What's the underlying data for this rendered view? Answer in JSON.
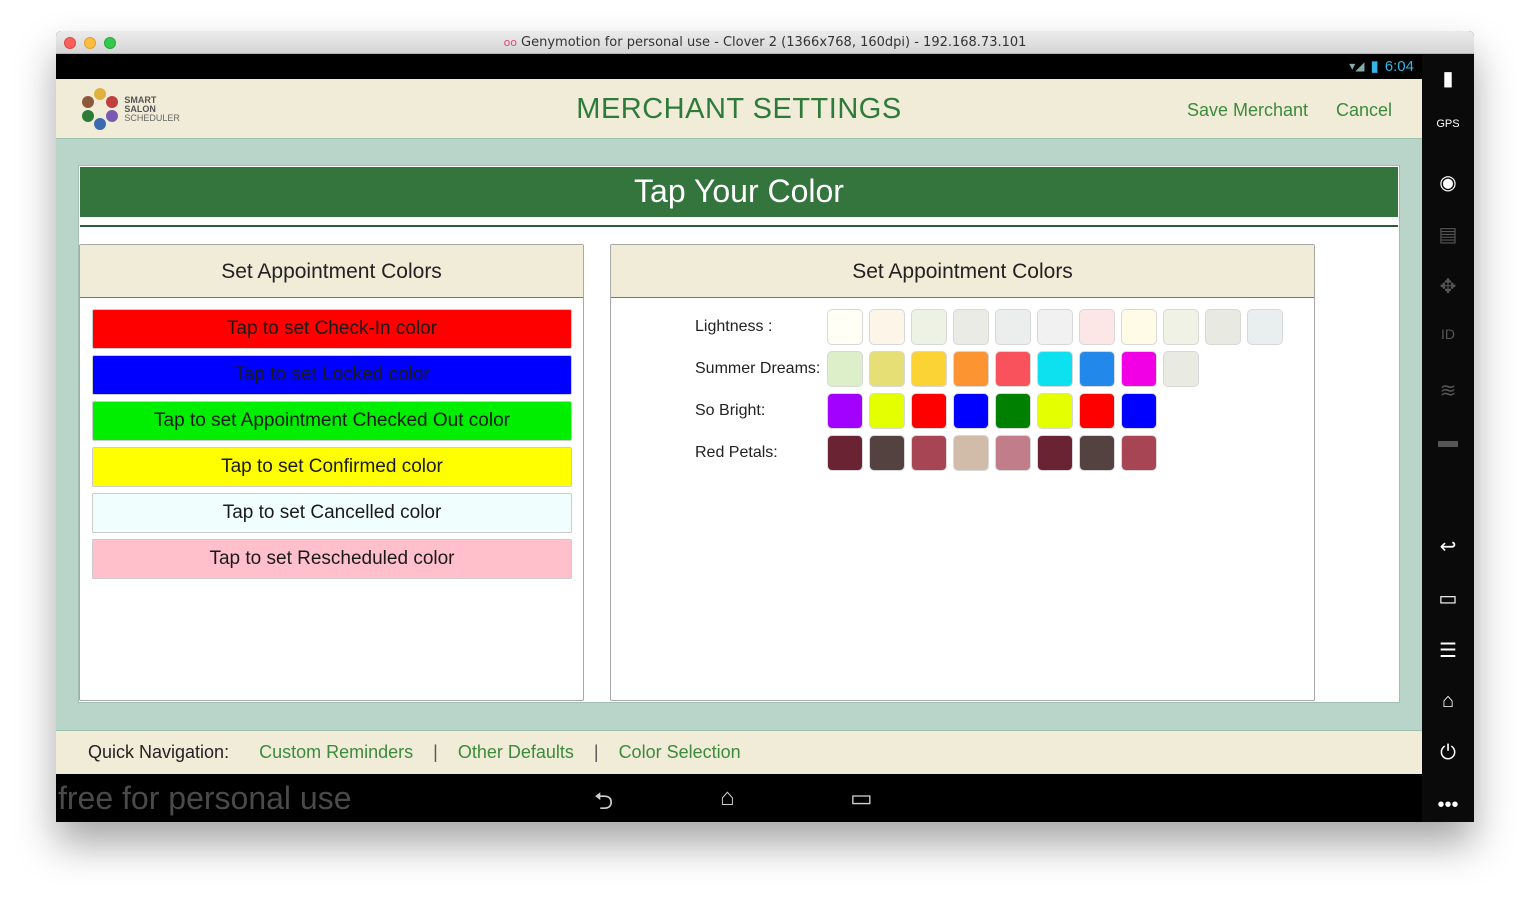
{
  "window": {
    "title": "Genymotion for personal use - Clover 2 (1366x768, 160dpi) - 192.168.73.101"
  },
  "statusbar": {
    "time": "6:04"
  },
  "header": {
    "logo_line1": "SMART SALON",
    "logo_line2": "SCHEDULER",
    "title": "MERCHANT SETTINGS",
    "save_label": "Save Merchant",
    "cancel_label": "Cancel"
  },
  "banner": {
    "title": "Tap Your Color"
  },
  "left_panel": {
    "heading": "Set Appointment Colors",
    "buttons": [
      {
        "label": "Tap to set Check-In color",
        "bg": "#ff0000",
        "fg": "#1a1a1a"
      },
      {
        "label": "Tap to set Locked color",
        "bg": "#0000ff",
        "fg": "#1a1a1a"
      },
      {
        "label": "Tap to set Appointment Checked Out color",
        "bg": "#00ee00",
        "fg": "#1a1a1a"
      },
      {
        "label": "Tap to set Confirmed color",
        "bg": "#ffff00",
        "fg": "#1a1a1a"
      },
      {
        "label": "Tap to set Cancelled color",
        "bg": "#f0fffe",
        "fg": "#1a1a1a"
      },
      {
        "label": "Tap to set Rescheduled color",
        "bg": "#ffc0cb",
        "fg": "#1a1a1a"
      }
    ]
  },
  "right_panel": {
    "heading": "Set Appointment Colors",
    "palettes": [
      {
        "label": "Lightness :",
        "colors": [
          "#fffff6",
          "#fcf5e8",
          "#eef2e4",
          "#ebebe5",
          "#eceeee",
          "#f1f1f1",
          "#fde6e6",
          "#fffbe6",
          "#eff2e5",
          "#e8eae2",
          "#e9eeee"
        ]
      },
      {
        "label": "Summer Dreams:",
        "colors": [
          "#dcefc8",
          "#e6df76",
          "#fbd335",
          "#fd9432",
          "#f9525c",
          "#0de1f0",
          "#2288e9",
          "#f100e6",
          "#e9ebe2"
        ]
      },
      {
        "label": "So Bright:",
        "colors": [
          "#a200ff",
          "#e3ff00",
          "#ff0000",
          "#0000ff",
          "#008000",
          "#e3ff00",
          "#ff0000",
          "#0000ff"
        ]
      },
      {
        "label": "Red Petals:",
        "colors": [
          "#6a2333",
          "#544240",
          "#a84554",
          "#d1bba9",
          "#c17d8a",
          "#6a2333",
          "#544240",
          "#a84554"
        ]
      }
    ]
  },
  "quicknav": {
    "label": "Quick Navigation:",
    "links": [
      "Custom Reminders",
      "Other Defaults",
      "Color Selection"
    ],
    "separator": "|"
  },
  "navbar": {
    "watermark": "free for personal use"
  }
}
